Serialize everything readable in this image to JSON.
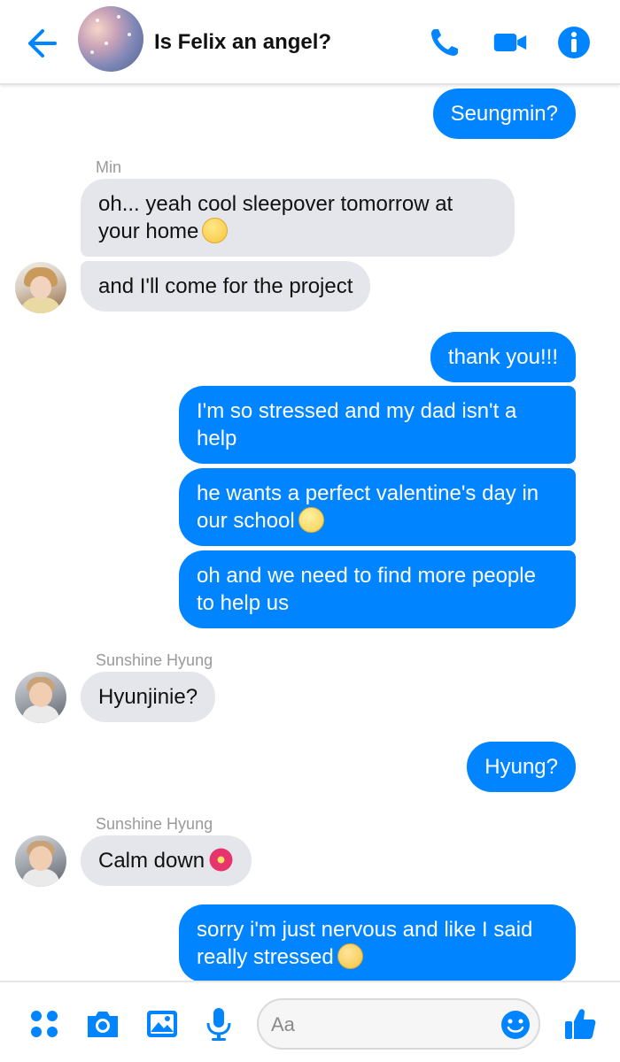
{
  "header": {
    "title": "Is Felix an angel?"
  },
  "messages": [
    {
      "text": "Seungmin?"
    },
    {
      "sender": "Min"
    },
    {
      "text": "oh... yeah cool sleepover tomorrow at your home"
    },
    {
      "text": "and I'll come for the project"
    },
    {
      "text": "thank you!!!"
    },
    {
      "text": "I'm so stressed and my dad isn't a help"
    },
    {
      "text": "he wants a perfect valentine's day in our school"
    },
    {
      "text": "oh and we need to find more people to help us"
    },
    {
      "sender": "Sunshine Hyung"
    },
    {
      "text": "Hyunjinie?"
    },
    {
      "text": "Hyung?"
    },
    {
      "sender": "Sunshine Hyung"
    },
    {
      "text": "Calm down"
    },
    {
      "text": "sorry i'm just nervous and like I said really stressed"
    }
  ],
  "composer": {
    "placeholder": "Aa"
  },
  "colors": {
    "accent": "#0084ff",
    "incoming_bubble": "#e4e6eb"
  },
  "icons": [
    "back-arrow-icon",
    "phone-icon",
    "video-camera-icon",
    "info-icon",
    "apps-grid-icon",
    "camera-icon",
    "image-icon",
    "microphone-icon",
    "emoji-icon",
    "thumbs-up-icon"
  ]
}
